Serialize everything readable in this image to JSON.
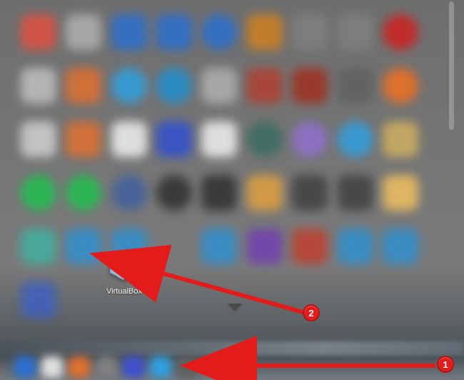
{
  "focused_app": {
    "name": "VirtualBox",
    "icon_name": "virtualbox-icon"
  },
  "annotations": {
    "step1_label": "1",
    "step2_label": "2"
  },
  "dock": {
    "stack_expand_label": "▼"
  },
  "blurred_grid": {
    "rows": 6,
    "cols": 9,
    "icons": [
      [
        {
          "c": "#e05040"
        },
        {
          "c": "#b0b0b0"
        },
        {
          "c": "#2a6fd0"
        },
        {
          "c": "#2a6fd0"
        },
        {
          "c": "#2a6fd0",
          "r": true
        },
        {
          "c": "#d08020"
        },
        {
          "c": "#808080"
        },
        {
          "c": "#808080"
        },
        {
          "c": "#d02020",
          "r": true
        }
      ],
      [
        {
          "c": "#c0c0c0"
        },
        {
          "c": "#e07030"
        },
        {
          "c": "#30a0e0",
          "r": true
        },
        {
          "c": "#2090d0",
          "r": true
        },
        {
          "c": "#b0b0b0"
        },
        {
          "c": "#b04030"
        },
        {
          "c": "#a03020"
        },
        {
          "c": "#606060"
        },
        {
          "c": "#f07020",
          "r": true
        }
      ],
      [
        {
          "c": "#d0d0d0"
        },
        {
          "c": "#e07030"
        },
        {
          "c": "#f0f0f0"
        },
        {
          "c": "#3050d0"
        },
        {
          "c": "#f0f0f0"
        },
        {
          "c": "#3a6c60",
          "r": true
        },
        {
          "c": "#9070d0",
          "r": true
        },
        {
          "c": "#30a0e0",
          "r": true
        },
        {
          "c": "#d0b060"
        }
      ],
      [
        {
          "c": "#20c050",
          "r": true
        },
        {
          "c": "#20c050",
          "r": true
        },
        {
          "c": "#4060a0",
          "r": true
        },
        {
          "c": "#303030",
          "r": true
        },
        {
          "c": "#303030"
        },
        {
          "c": "#e0a040"
        },
        {
          "c": "#404040"
        },
        {
          "c": "#404040"
        },
        {
          "c": "#f0c060"
        }
      ],
      [
        {
          "c": "#40b0a0"
        },
        {
          "c": "#3090d0"
        },
        {
          "c": "#3090d0"
        },
        {
          "c": null
        },
        {
          "c": "#3090d0"
        },
        {
          "c": "#7040b0"
        },
        {
          "c": "#c04030"
        },
        {
          "c": "#3090d0"
        },
        {
          "c": "#3090d0"
        }
      ],
      [
        {
          "c": "#4060c0"
        },
        {
          "c": null
        },
        {
          "c": null
        },
        {
          "c": null
        },
        {
          "c": null
        },
        {
          "c": null
        },
        {
          "c": null
        },
        {
          "c": null
        },
        {
          "c": null
        }
      ]
    ]
  }
}
